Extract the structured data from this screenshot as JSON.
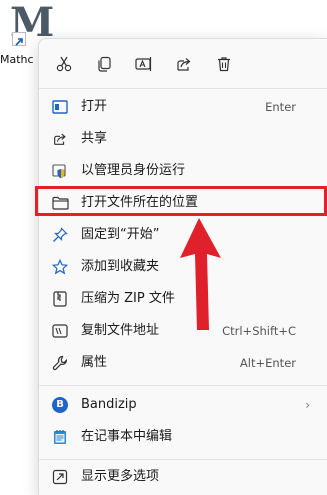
{
  "desktop": {
    "icon": {
      "label": "Mathc",
      "glyph": "M",
      "icon_name": "app-m-icon"
    }
  },
  "context_menu": {
    "quick_actions": [
      {
        "name": "cut",
        "icon": "scissors-icon"
      },
      {
        "name": "copy",
        "icon": "copy-icon"
      },
      {
        "name": "rename",
        "icon": "rename-icon"
      },
      {
        "name": "share",
        "icon": "share-icon"
      },
      {
        "name": "delete",
        "icon": "trash-icon"
      }
    ],
    "items": {
      "open": {
        "label": "打开",
        "shortcut": "Enter",
        "icon": "open-window-icon"
      },
      "share": {
        "label": "共享",
        "icon": "share-icon"
      },
      "run_as_admin": {
        "label": "以管理员身份运行",
        "icon": "shield-icon"
      },
      "open_file_location": {
        "label": "打开文件所在的位置",
        "icon": "folder-icon"
      },
      "pin_start": {
        "label": "固定到“开始”",
        "icon": "pin-icon"
      },
      "add_favorites": {
        "label": "添加到收藏夹",
        "icon": "star-icon"
      },
      "compress_zip": {
        "label": "压缩为 ZIP 文件",
        "icon": "zip-icon"
      },
      "copy_path": {
        "label": "复制文件地址",
        "shortcut": "Ctrl+Shift+C",
        "icon": "path-icon"
      },
      "properties": {
        "label": "属性",
        "shortcut": "Alt+Enter",
        "icon": "wrench-icon"
      },
      "bandizip": {
        "label": "Bandizip",
        "icon": "bandizip-icon",
        "badge": "B"
      },
      "notepad_edit": {
        "label": "在记事本中编辑",
        "icon": "notepad-icon"
      },
      "more_options": {
        "label": "显示更多选项",
        "icon": "more-options-icon"
      }
    }
  },
  "colors": {
    "highlight_border": "#e0202a",
    "annotation_arrow": "#e0202a",
    "menu_bg": "#f9f9f9",
    "accent": "#1f64c8"
  }
}
